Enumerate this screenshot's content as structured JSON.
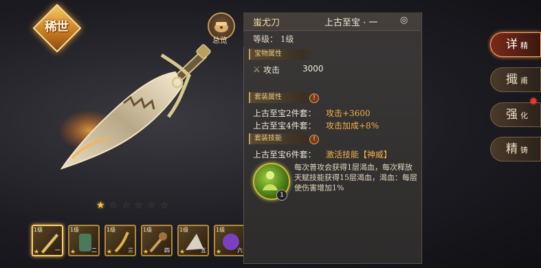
{
  "rarity_badge": "稀世",
  "overview": {
    "label": "总览",
    "icon": "treasure-chest-icon"
  },
  "stars": {
    "filled": 1,
    "total": 6
  },
  "thumbnails": [
    {
      "level": "1级",
      "num": "一",
      "selected": true
    },
    {
      "level": "1级",
      "num": "二",
      "selected": false
    },
    {
      "level": "1级",
      "num": "三",
      "selected": false
    },
    {
      "level": "1级",
      "num": "四",
      "selected": false
    },
    {
      "level": "1级",
      "num": "五",
      "selected": false
    },
    {
      "level": "1级",
      "num": "六",
      "selected": false
    }
  ],
  "panel": {
    "item_name": "蚩尤刀",
    "tier": "上古至宝 · 一",
    "level": "等级： 1级",
    "section_base": "宝物属性",
    "stat": {
      "label": "攻击",
      "value": "3000"
    },
    "section_set": "套装属性",
    "set_bonuses": [
      {
        "label": "上古至宝2件套：",
        "value": "攻击+3600"
      },
      {
        "label": "上古至宝4件套：",
        "value": "攻击加成+8%"
      }
    ],
    "section_skill": "套装技能",
    "skill_activate": {
      "label": "上古至宝6件套：",
      "value": "激活技能【神威】"
    },
    "skill_level": "1",
    "skill_desc": "每次普攻会获得1层渴血，每次释放天赋技能获得15层渴血，渴血：每层使伤害增加1%"
  },
  "tabs": [
    {
      "big": "详",
      "small": "精",
      "active": true
    },
    {
      "big": "擑",
      "small": "甫",
      "active": false
    },
    {
      "big": "强",
      "small": "化",
      "active": false
    },
    {
      "big": "精",
      "small": "铸",
      "active": false
    }
  ],
  "colors": {
    "accent": "#f2b24a",
    "panel": "#2e2b2b",
    "active_tab": "#7a2a18"
  }
}
